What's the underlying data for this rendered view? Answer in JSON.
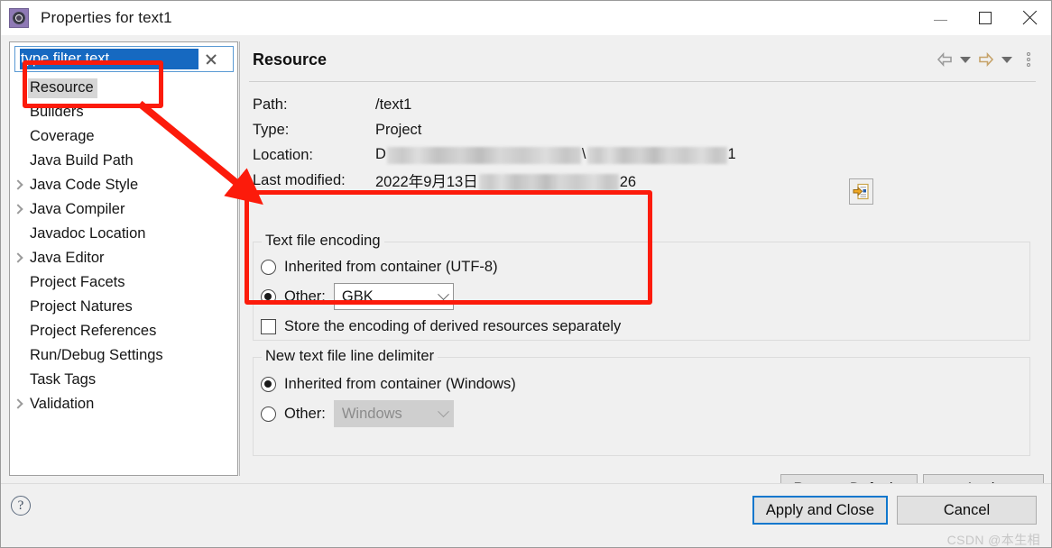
{
  "window": {
    "title": "Properties for text1",
    "app_icon": "properties-gear-icon",
    "minimize_label": "Minimize",
    "maximize_label": "Maximize",
    "close_label": "Close"
  },
  "filter": {
    "value": "type filter text",
    "placeholder": "type filter text",
    "clear_label": "Clear"
  },
  "tree": {
    "items": [
      {
        "label": "Resource",
        "expandable": false,
        "selected": true
      },
      {
        "label": "Builders",
        "expandable": false,
        "selected": false
      },
      {
        "label": "Coverage",
        "expandable": false,
        "selected": false
      },
      {
        "label": "Java Build Path",
        "expandable": false,
        "selected": false
      },
      {
        "label": "Java Code Style",
        "expandable": true,
        "selected": false
      },
      {
        "label": "Java Compiler",
        "expandable": true,
        "selected": false
      },
      {
        "label": "Javadoc Location",
        "expandable": false,
        "selected": false
      },
      {
        "label": "Java Editor",
        "expandable": true,
        "selected": false
      },
      {
        "label": "Project Facets",
        "expandable": false,
        "selected": false
      },
      {
        "label": "Project Natures",
        "expandable": false,
        "selected": false
      },
      {
        "label": "Project References",
        "expandable": false,
        "selected": false
      },
      {
        "label": "Run/Debug Settings",
        "expandable": false,
        "selected": false
      },
      {
        "label": "Task Tags",
        "expandable": false,
        "selected": false
      },
      {
        "label": "Validation",
        "expandable": true,
        "selected": false
      }
    ]
  },
  "page": {
    "title": "Resource",
    "nav": {
      "back_icon": "arrow-left-icon",
      "back_menu_icon": "chevron-down-icon",
      "forward_icon": "arrow-right-icon",
      "forward_menu_icon": "chevron-down-icon",
      "overflow_icon": "vertical-dots-icon"
    },
    "info": {
      "path_label": "Path:",
      "path_value": "/text1",
      "type_label": "Type:",
      "type_value": "Project",
      "location_label": "Location:",
      "location_prefix": "D",
      "location_sep": "\\",
      "location_suffix": "1",
      "location_redacted": true,
      "location_button_icon": "open-resource-icon",
      "modified_label": "Last modified:",
      "modified_value": "2022年9月13日",
      "modified_suffix": "26"
    },
    "encoding_group": {
      "legend": "Text file encoding",
      "inherited_label": "Inherited from container (UTF-8)",
      "inherited_selected": false,
      "other_label": "Other:",
      "other_selected": true,
      "other_value": "GBK",
      "store_label": "Store the encoding of derived resources separately",
      "store_checked": false
    },
    "delimiter_group": {
      "legend": "New text file line delimiter",
      "inherited_label": "Inherited from container (Windows)",
      "inherited_selected": true,
      "other_label": "Other:",
      "other_selected": false,
      "other_value": "Windows",
      "other_disabled": true
    },
    "restore_defaults_label": "Restore Defaults",
    "apply_label": "Apply"
  },
  "footer": {
    "help_icon": "help-icon",
    "help_glyph": "?",
    "apply_and_close_label": "Apply and Close",
    "cancel_label": "Cancel",
    "watermark": "CSDN @本生相"
  },
  "annotations": {
    "accent_color": "#fc1b0b",
    "resource_box": "highlight-resource-tree-item",
    "encoding_box": "highlight-text-file-encoding",
    "arrow": "pointer-arrow"
  }
}
